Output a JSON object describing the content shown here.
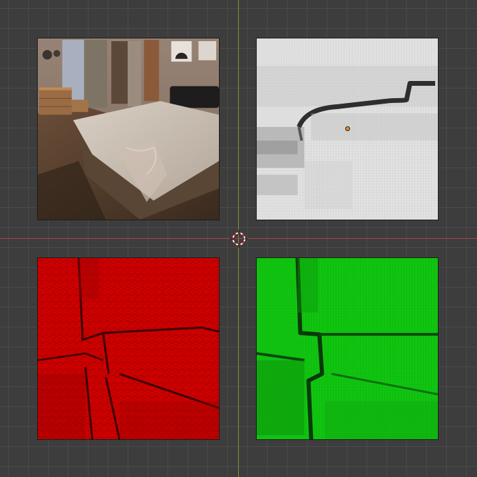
{
  "viewport": {
    "background_color": "#3d3d3d",
    "grid_color": "#4a4a4a",
    "x_axis_color": "#a8454f",
    "y_axis_color": "#7c9a38"
  },
  "planes": [
    {
      "name": "bedroom-photo",
      "kind": "color-image"
    },
    {
      "name": "grayscale-map",
      "kind": "grayscale-image",
      "tint": "#e6e6e6"
    },
    {
      "name": "red-channel-map",
      "kind": "channel-image",
      "tint": "#cc0000"
    },
    {
      "name": "green-channel-map",
      "kind": "channel-image",
      "tint": "#00cc00"
    }
  ],
  "cursor": {
    "icon": "3d-cursor-icon"
  },
  "origin": {
    "icon": "object-origin-icon",
    "color": "#f08a2a"
  }
}
